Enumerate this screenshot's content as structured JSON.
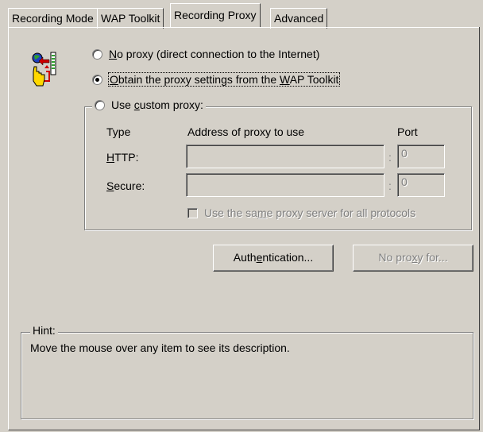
{
  "tabs": [
    {
      "label": "Recording Mode",
      "active": false
    },
    {
      "label": "WAP Toolkit",
      "active": false
    },
    {
      "label": "Recording Proxy",
      "active": true
    },
    {
      "label": "Advanced",
      "active": false
    }
  ],
  "icon": "proxy-settings-icon",
  "options": {
    "no_proxy": {
      "prefix": "",
      "accel": "N",
      "rest": "o proxy (direct connection to the Internet)",
      "checked": false
    },
    "obtain": {
      "prefix": "",
      "accel": "O",
      "rest": "btain the proxy settings from the ",
      "accel2": "W",
      "rest2": "AP Toolkit",
      "checked": true
    },
    "custom": {
      "prefix": "Use ",
      "accel": "c",
      "rest": "ustom proxy:",
      "checked": false
    }
  },
  "custom_group": {
    "headers": {
      "type": "Type",
      "address": "Address of proxy to use",
      "port": "Port"
    },
    "http": {
      "accel": "H",
      "rest": "TTP:",
      "address": "",
      "port_value": "0"
    },
    "secure": {
      "accel": "S",
      "rest": "ecure:",
      "address": "",
      "port_value": "0"
    },
    "separator": ":",
    "same_proxy": {
      "prefix": "Use the sa",
      "accel": "m",
      "rest": "e proxy server for all protocols",
      "checked": false
    }
  },
  "buttons": {
    "auth": {
      "prefix": "Auth",
      "accel": "e",
      "rest": "ntication..."
    },
    "no_proxy_for": {
      "prefix": "No pro",
      "accel": "x",
      "rest": "y for..."
    }
  },
  "hint": {
    "legend": "Hint:",
    "text": "Move the mouse over any item to see its description."
  }
}
